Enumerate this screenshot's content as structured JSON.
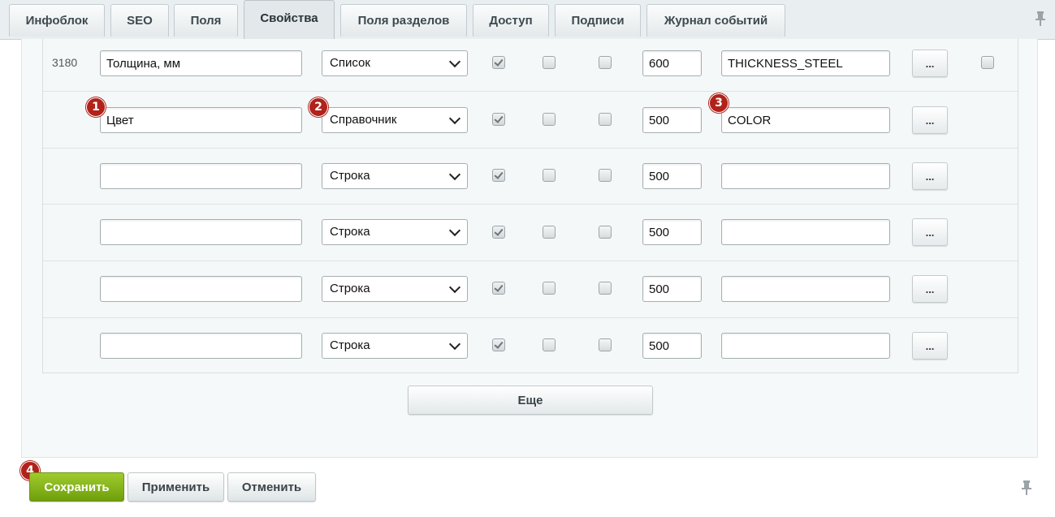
{
  "tabs": [
    {
      "label": "Инфоблок",
      "active": false
    },
    {
      "label": "SEO",
      "active": false
    },
    {
      "label": "Поля",
      "active": false
    },
    {
      "label": "Свойства",
      "active": true
    },
    {
      "label": "Поля разделов",
      "active": false
    },
    {
      "label": "Доступ",
      "active": false
    },
    {
      "label": "Подписи",
      "active": false
    },
    {
      "label": "Журнал событий",
      "active": false
    }
  ],
  "properties": [
    {
      "id": "3180",
      "name": "Толщина, мм",
      "type": "Список",
      "c1": true,
      "c2": false,
      "c3": false,
      "sort": "600",
      "code": "THICKNESS_STEEL",
      "edit": "...",
      "delete_checkbox": true
    },
    {
      "id": "",
      "name": "Цвет",
      "type": "Справочник",
      "c1": true,
      "c2": false,
      "c3": false,
      "sort": "500",
      "code": "COLOR",
      "edit": "...",
      "delete_checkbox": false
    },
    {
      "id": "",
      "name": "",
      "type": "Строка",
      "c1": true,
      "c2": false,
      "c3": false,
      "sort": "500",
      "code": "",
      "edit": "...",
      "delete_checkbox": false
    },
    {
      "id": "",
      "name": "",
      "type": "Строка",
      "c1": true,
      "c2": false,
      "c3": false,
      "sort": "500",
      "code": "",
      "edit": "...",
      "delete_checkbox": false
    },
    {
      "id": "",
      "name": "",
      "type": "Строка",
      "c1": true,
      "c2": false,
      "c3": false,
      "sort": "500",
      "code": "",
      "edit": "...",
      "delete_checkbox": false
    },
    {
      "id": "",
      "name": "",
      "type": "Строка",
      "c1": true,
      "c2": false,
      "c3": false,
      "sort": "500",
      "code": "",
      "edit": "...",
      "delete_checkbox": false
    }
  ],
  "more_button": "Еще",
  "badges": [
    "1",
    "2",
    "3",
    "4"
  ],
  "footer": {
    "save": "Сохранить",
    "apply": "Применить",
    "cancel": "Отменить"
  },
  "colors": {
    "accent_green": "#7aab13",
    "badge_red": "#b0221a"
  },
  "icons": {
    "pin": "pin-icon"
  }
}
